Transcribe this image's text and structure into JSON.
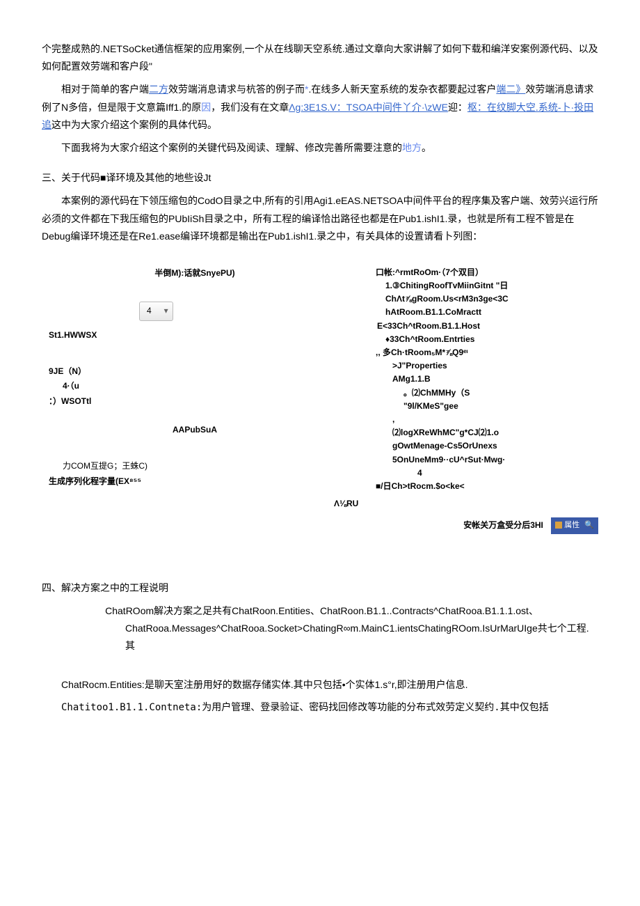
{
  "intro": {
    "p1_a": "个完整成熟的.NETSoCket通信框架的应用案例,一个从在线聊天空系统.通过文章向大家讲解了如何下载和编洋安案例源代码、以及如何配置效劳端和客户段\"",
    "p2_a": "相对于简单的客户端",
    "p2_link1": "二方",
    "p2_b": "效劳端消息请求与杭答的例子而",
    "p2_link2": "*",
    "p2_c": ".在线多人新天室系统的发杂衣都要起过客户",
    "p2_link3": "端二》",
    "p2_d": "效劳端消息请求例了N多倍，但是限于文意篇Iff1.的原",
    "p2_link4": "因",
    "p2_e": "，我们没有在文章",
    "p2_link5": "Λg:3E1S.V：TSOA中间件丫介·\\zWE",
    "p2_f": "迎：",
    "p2_link6": "枢：在纹脚大空.系统-卜·投田追",
    "p2_g": "这中为大家介绍这个案例的具体代码。",
    "p3_a": "下面我将为大家介绍这个案例的关键代码及阅读、理解、修改完善所需要注意的",
    "p3_link": "地方",
    "p3_b": "。"
  },
  "section3": {
    "title": "三、关于代码■译环境及其他的地些设Jt",
    "p1": "本案例的源代码在下领压缩包的CodO目录之中,所有的引用Agi1.eEAS.NETSOA中间件平台的程序集及客户端、效劳兴运行所必须的文件都在下我压缩包的PUbIiSh目录之中，所有工程的编译恰出路径也都是在Pub1.ishI1.录，也就是所有工程不管是在Debug编译环境还是在Re1.ease编译环境都是输出在Pub1.ishI1.录之中，有关具体的设置请看卜列图："
  },
  "diagram": {
    "left": {
      "row1": "半倒M):话就SnyePU)",
      "dropdown": "4",
      "st1": "St1.HWWSX",
      "nine": "9JE（N）",
      "four": "4·（u",
      "wsot": "：）WSOTtl",
      "aapub": "AAPubSuA",
      "com": "力COM互提G；王蛛C)",
      "gen": "生成序列化程字量(EX⁸⁵⁵"
    },
    "right": {
      "header": "口帐:^rmtRoOm·（7个双目）",
      "l1": "1.③ChitingRoofTvMiinGitnt \"日",
      "l2": "ChΛt⅞gRoom.Us<rM3n3ge<3C",
      "l3": "hAtRoom.B1.1.CoMractt",
      "l4": "E<33Ch^tRoom.B1.1.Host",
      "l5": "♦33Ch^tRoom.Entrties",
      "l6": ",, 多Ch·tRoom₅M*⅞Q9ᵉᶦ",
      "l7": ">J\"Properties",
      "l8": "AMg1.1.B",
      "l9": "。⑵ChMMHy（S",
      "l10": "\"9l/KMeS\"gee",
      "l11": ",",
      "l12": "⑵logXReWhMC\"g*CJ⑵1.o",
      "l13": "gOwtMenage-Cs5OrUnexs",
      "l14": "5OnUneMm9··cU^rSut·Mwg·",
      "l15": "4",
      "l16": "■/日Ch>tRocm.$o<ke<",
      "ru": "Λ⅛RU",
      "footer": "安帐关万盒受分后3HI",
      "tagtext": "属性"
    }
  },
  "section4": {
    "title": "四、解决方案之中的工程说明",
    "p1": "ChatROom解决方案之足共有ChatRoon.Entities、ChatRoon.B1.1..Contracts^ChatRooa.B1.1.1.ost、ChatRooa.Messages^ChatRooa.Socket>ChatingR∞m.MainC1.ientsChatingROom.IsUrMarUIge共七个工程.其",
    "p2": "ChatRocm.Entities:是聊天室注册用好的数据存储实体.其中只包括•个实体1.s°r,即注册用户信息.",
    "p3": "Chatitoo1.B1.1.Contneta:为用户管理、登录验证、密码找回修改等功能的分布式效劳定义契约.其中仅包括"
  }
}
